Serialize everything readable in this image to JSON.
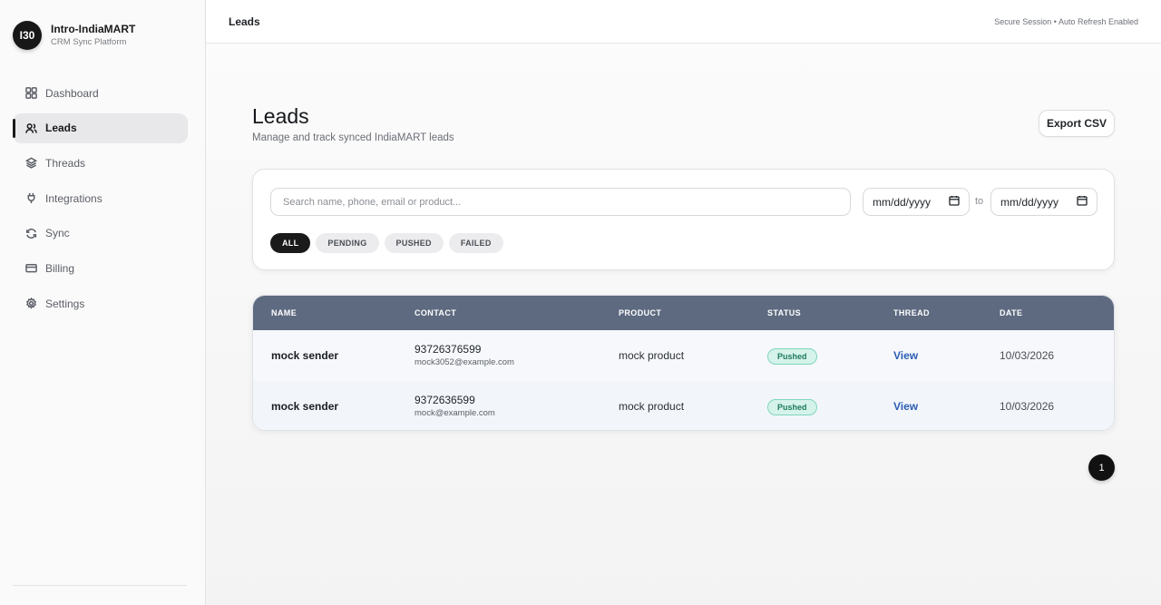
{
  "brand": {
    "logo_text": "I30",
    "name": "Intro-IndiaMART",
    "subtitle": "CRM Sync Platform"
  },
  "sidebar": {
    "items": [
      {
        "label": "Dashboard",
        "icon": "grid-icon",
        "active": false
      },
      {
        "label": "Leads",
        "icon": "users-icon",
        "active": true
      },
      {
        "label": "Threads",
        "icon": "layers-icon",
        "active": false
      },
      {
        "label": "Integrations",
        "icon": "plug-icon",
        "active": false
      },
      {
        "label": "Sync",
        "icon": "refresh-icon",
        "active": false
      },
      {
        "label": "Billing",
        "icon": "credit-card-icon",
        "active": false
      },
      {
        "label": "Settings",
        "icon": "gear-icon",
        "active": false
      }
    ]
  },
  "topbar": {
    "title": "Leads",
    "status": "Secure Session • Auto Refresh Enabled"
  },
  "page": {
    "title": "Leads",
    "subtitle": "Manage and track synced IndiaMART leads",
    "export_label": "Export CSV"
  },
  "filters": {
    "search_placeholder": "Search name, phone, email or product...",
    "date_from": "mm/dd/yyyy",
    "to_label": "to",
    "date_to": "mm/dd/yyyy",
    "chips": [
      {
        "label": "ALL",
        "active": true
      },
      {
        "label": "PENDING",
        "active": false
      },
      {
        "label": "PUSHED",
        "active": false
      },
      {
        "label": "FAILED",
        "active": false
      }
    ]
  },
  "table": {
    "headers": [
      "NAME",
      "CONTACT",
      "PRODUCT",
      "STATUS",
      "THREAD",
      "DATE"
    ],
    "rows": [
      {
        "name": "mock sender",
        "phone": "93726376599",
        "email": "mock3052@example.com",
        "product": "mock product",
        "status": "Pushed",
        "thread": "View",
        "date": "10/03/2026"
      },
      {
        "name": "mock sender",
        "phone": "9372636599",
        "email": "mock@example.com",
        "product": "mock product",
        "status": "Pushed",
        "thread": "View",
        "date": "10/03/2026"
      }
    ]
  },
  "pagination": {
    "current": "1"
  },
  "colors": {
    "accent": "#1a1a1a",
    "table_header": "#5d6a80",
    "badge_bg": "#d5f3ea",
    "link": "#2b5db3"
  }
}
